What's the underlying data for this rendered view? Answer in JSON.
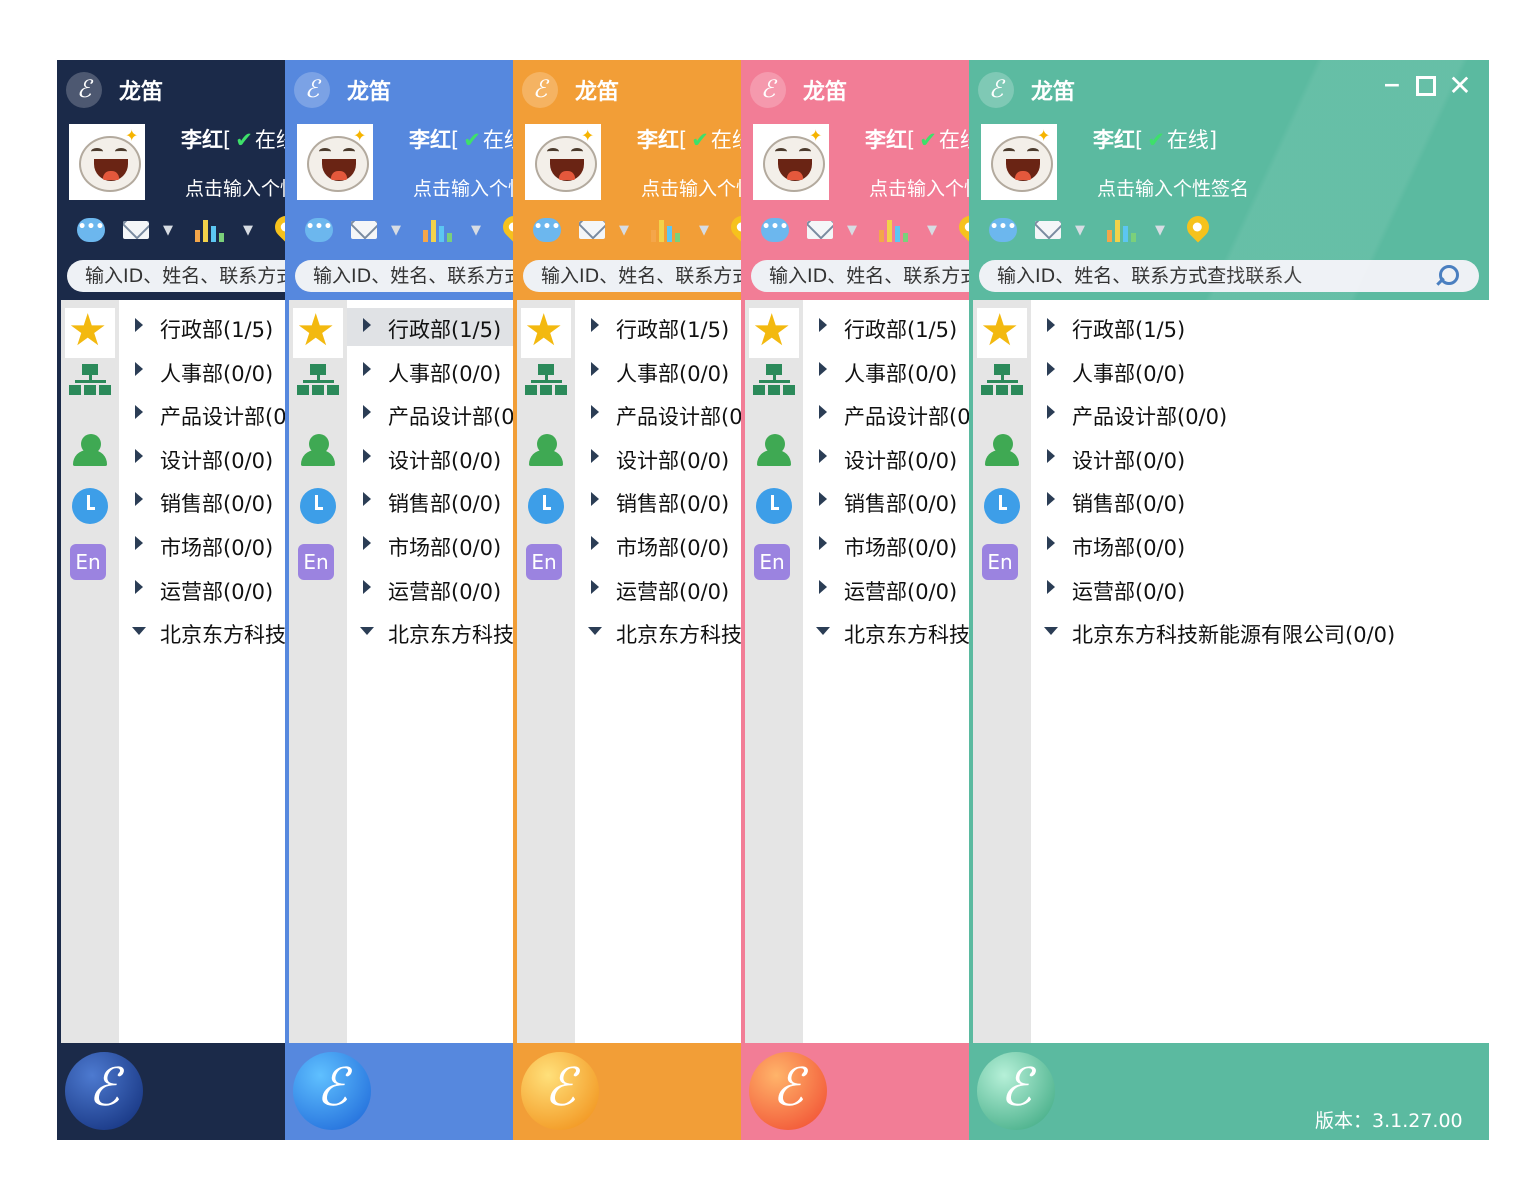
{
  "app_title": "龙笛",
  "app_logo_glyph": "ℰ",
  "window_controls": {
    "minimize": "−",
    "close": "✕"
  },
  "user": {
    "name": "李红",
    "status_open": "[",
    "status_check": "✔",
    "status_text": "在线",
    "status_close": "]",
    "signature": "点击输入个性签名"
  },
  "toolbar": {
    "chat_glyph": "•••",
    "dropdown_glyph": "▼"
  },
  "search": {
    "placeholder": "输入ID、姓名、联系方式查找联系人"
  },
  "sidebar": {
    "en_label": "En"
  },
  "departments": [
    {
      "label": "行政部(1/5)",
      "expanded": false
    },
    {
      "label": "人事部(0/0)",
      "expanded": false
    },
    {
      "label": "产品设计部(0/0)",
      "expanded": false
    },
    {
      "label": "设计部(0/0)",
      "expanded": false
    },
    {
      "label": "销售部(0/0)",
      "expanded": false
    },
    {
      "label": "市场部(0/0)",
      "expanded": false
    },
    {
      "label": "运营部(0/0)",
      "expanded": false
    },
    {
      "label": "北京东方科技新能源有限公司(0/0)",
      "expanded": true
    }
  ],
  "version": "版本：3.1.27.00",
  "themes": [
    {
      "name": "dark-navy",
      "main": "#1b2a49",
      "logo_hi": "#4d7ad0",
      "logo_lo": "#0f2b76",
      "selected_dept": null
    },
    {
      "name": "blue",
      "main": "#5688de",
      "logo_hi": "#5fc0ff",
      "logo_lo": "#1a62d6",
      "selected_dept": 0
    },
    {
      "name": "orange",
      "main": "#f29e37",
      "logo_hi": "#ffe07a",
      "logo_lo": "#f08a12",
      "selected_dept": null
    },
    {
      "name": "pink",
      "main": "#f27d96",
      "logo_hi": "#ffb46a",
      "logo_lo": "#f0462e",
      "selected_dept": null
    },
    {
      "name": "teal",
      "main": "#5bbaa0",
      "logo_hi": "#b6f0d8",
      "logo_lo": "#35a47c",
      "selected_dept": null
    }
  ]
}
